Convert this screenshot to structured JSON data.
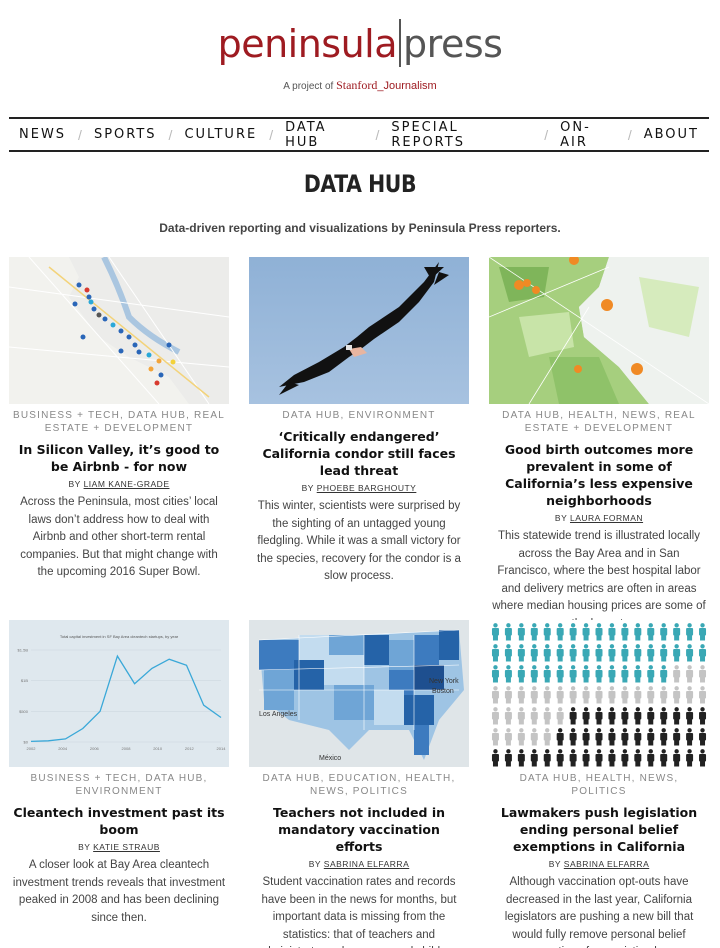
{
  "site": {
    "logo_part1": "peninsula",
    "logo_part2": "press",
    "tagline_prefix": "A project of",
    "tagline_stanford": "Stanford",
    "tagline_journalism": "Journalism"
  },
  "nav": {
    "items": [
      {
        "label": "NEWS"
      },
      {
        "label": "SPORTS"
      },
      {
        "label": "CULTURE"
      },
      {
        "label": "DATA HUB"
      },
      {
        "label": "SPECIAL REPORTS"
      },
      {
        "label": "ON-AIR"
      },
      {
        "label": "ABOUT"
      }
    ]
  },
  "page": {
    "title": "DATA HUB",
    "description": "Data-driven reporting and visualizations by Peninsula Press reporters."
  },
  "articles": [
    {
      "categories": "BUSINESS + TECH, DATA HUB, REAL ESTATE + DEVELOPMENT",
      "title": "In Silicon Valley, it’s good to be Airbnb - for now",
      "by": "BY",
      "author": "LIAM KANE-GRADE",
      "excerpt": "Across the Peninsula, most cities’ local laws don’t address how to deal with Airbnb and other short-term rental companies. But that might change with the upcoming 2016 Super Bowl.",
      "image": "map-icon"
    },
    {
      "categories": "DATA HUB, ENVIRONMENT",
      "title": "‘Critically endangered’ California condor still faces lead threat",
      "by": "BY",
      "author": "PHOEBE BARGHOUTY",
      "excerpt": "This winter, scientists were surprised by the sighting of an untagged young fledgling. While it was a small victory for the species, recovery for the condor is a slow process.",
      "image": "condor-photo"
    },
    {
      "categories": "DATA HUB, HEALTH, NEWS, REAL ESTATE + DEVELOPMENT",
      "title": "Good birth outcomes more prevalent in some of California’s less expensive neighborhoods",
      "by": "BY",
      "author": "LAURA FORMAN",
      "excerpt": "This statewide trend is illustrated locally across the Bay Area and in San Francisco, where the best hospital labor and delivery metrics are often in areas where median housing prices are some of the lowest.",
      "image": "green-map"
    },
    {
      "categories": "BUSINESS + TECH, DATA HUB, ENVIRONMENT",
      "title": "Cleantech investment past its boom",
      "by": "BY",
      "author": "KATIE STRAUB",
      "excerpt": "A closer look at Bay Area cleantech investment trends reveals that investment peaked in 2008 and has been declining since then.",
      "image": "line-chart"
    },
    {
      "categories": "DATA HUB, EDUCATION, HEALTH, NEWS, POLITICS",
      "title": "Teachers not included in mandatory vaccination efforts",
      "by": "BY",
      "author": "SABRINA ELFARRA",
      "excerpt": "Student vaccination rates and records have been in the news for months, but important data is missing from the statistics: that of teachers and administrators who are around children.",
      "image": "us-map",
      "map_labels": [
        "Los Angeles",
        "New York",
        "Boston",
        "México"
      ]
    },
    {
      "categories": "DATA HUB, HEALTH, NEWS, POLITICS",
      "title": "Lawmakers push legislation ending personal belief exemptions in California",
      "by": "BY",
      "author": "SABRINA ELFARRA",
      "excerpt": "Although vaccination opt-outs have decreased in the last year, California legislators are pushing a new bill that would fully remove personal belief exemptions from existing law.",
      "image": "people-grid"
    }
  ],
  "thumb_chart": {
    "title": "Total capital investment in SF Bay Area cleantech startups, by year",
    "x_labels": [
      "2002",
      "2004",
      "2006",
      "2008",
      "2010",
      "2012",
      "2014"
    ],
    "y_labels": [
      "$0",
      "$500",
      "$1B",
      "$1.5B"
    ],
    "values": [
      0.01,
      0.02,
      0.05,
      0.22,
      0.5,
      1.4,
      0.95,
      1.2,
      1.35,
      1.25,
      0.6,
      0.4
    ]
  },
  "colors": {
    "brand_red": "#9e1b21",
    "teal": "#3aa8b5",
    "dark": "#222222"
  }
}
